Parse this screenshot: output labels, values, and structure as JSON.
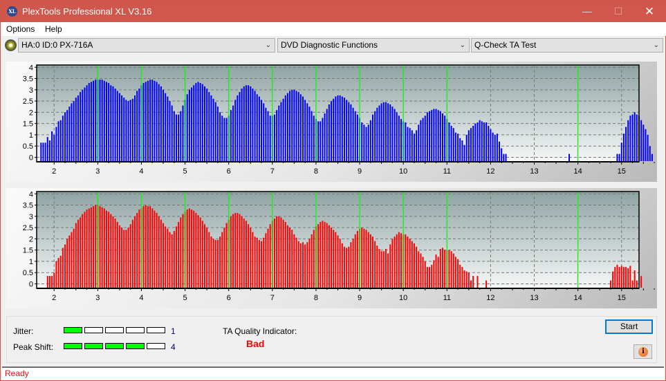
{
  "window": {
    "title": "PlexTools Professional XL V3.16",
    "logo_text": "XL",
    "minimize_icon": "minimize-icon",
    "maximize_icon": "maximize-icon",
    "close_icon": "close-icon"
  },
  "menu": [
    "Options",
    "Help"
  ],
  "toolbar": {
    "drive_icon": "disc-drive-icon",
    "drive": "HA:0 ID:0  PX-716A",
    "function": "DVD Diagnostic Functions",
    "test": "Q-Check TA Test"
  },
  "results": {
    "jitter_label": "Jitter:",
    "jitter_value": "1",
    "jitter_level": 1,
    "peak_shift_label": "Peak Shift:",
    "peak_shift_value": "4",
    "peak_shift_level": 4,
    "segments_total": 5,
    "ta_quality_label": "TA Quality Indicator:",
    "ta_quality_value": "Bad",
    "start_label": "Start",
    "info_icon": "info-icon"
  },
  "status": "Ready",
  "colors": {
    "titlebar": "#d0574b",
    "series_top": "#0000ff",
    "series_bottom": "#ff0000",
    "marker_lines": "#00ff00",
    "level_on": "#00ff00",
    "bad": "#ff0000"
  },
  "chart_data": [
    {
      "type": "bar",
      "name": "TA land/pit histogram (top)",
      "color": "#0000ff",
      "xlim": [
        1.6,
        15.4
      ],
      "ylim": [
        -0.2,
        4.1
      ],
      "xticks": [
        2,
        3,
        4,
        5,
        6,
        7,
        8,
        9,
        10,
        11,
        12,
        13,
        14,
        15
      ],
      "yticks": [
        0,
        0.5,
        1,
        1.5,
        2,
        2.5,
        3,
        3.5,
        4
      ],
      "ytick_labels": [
        "0",
        "0.5",
        "1",
        "1.5",
        "2",
        "2.5",
        "3",
        "3.5",
        "4"
      ],
      "marker_lines_x": [
        3,
        4,
        5,
        6,
        7,
        8,
        9,
        10,
        11,
        14
      ],
      "grid": true,
      "x_start": 1.7,
      "x_step": 0.05,
      "values": [
        0.65,
        0.65,
        0.65,
        0.9,
        0.75,
        1.15,
        1.0,
        1.35,
        1.6,
        1.65,
        1.85,
        2.0,
        2.1,
        2.25,
        2.4,
        2.5,
        2.65,
        2.75,
        2.9,
        3.0,
        3.1,
        3.2,
        3.3,
        3.35,
        3.4,
        3.45,
        3.45,
        3.45,
        3.45,
        3.4,
        3.35,
        3.3,
        3.2,
        3.15,
        3.05,
        2.95,
        2.85,
        2.75,
        2.65,
        2.55,
        2.5,
        2.55,
        2.6,
        2.75,
        2.95,
        3.05,
        3.2,
        3.3,
        3.35,
        3.4,
        3.45,
        3.45,
        3.4,
        3.35,
        3.25,
        3.15,
        3.0,
        2.85,
        2.7,
        2.5,
        2.3,
        2.05,
        1.9,
        1.9,
        2.05,
        2.3,
        2.55,
        2.8,
        3.0,
        3.1,
        3.2,
        3.3,
        3.35,
        3.3,
        3.25,
        3.15,
        3.05,
        2.9,
        2.75,
        2.6,
        2.45,
        2.25,
        2.0,
        1.85,
        1.75,
        1.75,
        1.85,
        2.1,
        2.3,
        2.55,
        2.75,
        2.9,
        3.05,
        3.15,
        3.2,
        3.2,
        3.15,
        3.05,
        2.95,
        2.8,
        2.7,
        2.55,
        2.4,
        2.2,
        2.05,
        1.85,
        1.85,
        1.9,
        2.1,
        2.3,
        2.45,
        2.6,
        2.75,
        2.85,
        2.95,
        3.0,
        3.0,
        2.95,
        2.9,
        2.8,
        2.7,
        2.55,
        2.4,
        2.25,
        2.05,
        1.85,
        1.7,
        1.6,
        1.6,
        1.75,
        1.95,
        2.15,
        2.35,
        2.5,
        2.6,
        2.7,
        2.75,
        2.75,
        2.7,
        2.65,
        2.55,
        2.45,
        2.35,
        2.2,
        2.05,
        1.9,
        1.75,
        1.55,
        1.45,
        1.35,
        1.45,
        1.65,
        1.9,
        2.05,
        2.2,
        2.3,
        2.4,
        2.45,
        2.45,
        2.4,
        2.35,
        2.25,
        2.15,
        2.0,
        1.85,
        1.7,
        1.6,
        1.55,
        1.35,
        1.3,
        1.2,
        1.05,
        1.2,
        1.45,
        1.65,
        1.75,
        1.85,
        2.0,
        2.05,
        2.1,
        2.15,
        2.15,
        2.1,
        2.05,
        1.95,
        1.85,
        1.7,
        1.55,
        1.4,
        1.3,
        1.1,
        1.05,
        0.85,
        0.75,
        0.55,
        1.0,
        1.2,
        1.3,
        1.4,
        1.5,
        1.55,
        1.65,
        1.6,
        1.55,
        1.55,
        1.4,
        1.25,
        1.1,
        1.0,
        1.05,
        0.7,
        0.4,
        0.15,
        0.15,
        0,
        0,
        0,
        0,
        0,
        0,
        0,
        0,
        0,
        0,
        0,
        0,
        0,
        0,
        0,
        0,
        0,
        0,
        0,
        0,
        0,
        0,
        0,
        0,
        0,
        0,
        0,
        0,
        0.15,
        0,
        0,
        0,
        0,
        0,
        0,
        0,
        0,
        0,
        0,
        0,
        0,
        0,
        0,
        0,
        0,
        0,
        0,
        0,
        0,
        0,
        0.15,
        0.15,
        0.65,
        1.05,
        1.35,
        1.65,
        1.85,
        1.9,
        2.0,
        1.9,
        1.85,
        1.65,
        1.45,
        1.25,
        1.0,
        0.5,
        0.15,
        0,
        0,
        0,
        0,
        0,
        0,
        0,
        0,
        0,
        0,
        0,
        0,
        0.15,
        0,
        0,
        0,
        0,
        0
      ]
    },
    {
      "type": "bar",
      "name": "TA land/pit histogram (bottom)",
      "color": "#ff0000",
      "xlim": [
        1.6,
        15.4
      ],
      "ylim": [
        -0.2,
        4.1
      ],
      "xticks": [
        2,
        3,
        4,
        5,
        6,
        7,
        8,
        9,
        10,
        11,
        12,
        13,
        14,
        15
      ],
      "yticks": [
        0,
        0.5,
        1,
        1.5,
        2,
        2.5,
        3,
        3.5,
        4
      ],
      "ytick_labels": [
        "0",
        "0.5",
        "1",
        "1.5",
        "2",
        "2.5",
        "3",
        "3.5",
        "4"
      ],
      "marker_lines_x": [
        3,
        4,
        5,
        6,
        7,
        8,
        9,
        10,
        11,
        14
      ],
      "grid": true,
      "x_start": 1.7,
      "x_step": 0.05,
      "values": [
        0,
        0,
        0,
        0.35,
        0.35,
        0.35,
        0.5,
        1.0,
        1.15,
        1.25,
        1.6,
        1.75,
        2.0,
        2.15,
        2.3,
        2.45,
        2.7,
        2.85,
        2.95,
        3.1,
        3.2,
        3.3,
        3.35,
        3.4,
        3.45,
        3.5,
        3.5,
        3.45,
        3.4,
        3.35,
        3.25,
        3.2,
        3.1,
        3.0,
        2.9,
        2.75,
        2.6,
        2.5,
        2.4,
        2.4,
        2.5,
        2.65,
        2.85,
        3.0,
        3.15,
        3.3,
        3.35,
        3.45,
        3.5,
        3.45,
        3.45,
        3.35,
        3.25,
        3.15,
        3.0,
        2.85,
        2.7,
        2.55,
        2.45,
        2.3,
        2.2,
        2.35,
        2.55,
        2.75,
        2.95,
        3.1,
        3.2,
        3.3,
        3.35,
        3.3,
        3.25,
        3.15,
        3.05,
        2.95,
        2.8,
        2.65,
        2.5,
        2.3,
        2.1,
        2.0,
        1.95,
        1.95,
        2.1,
        2.3,
        2.5,
        2.7,
        2.85,
        3.0,
        3.1,
        3.15,
        3.15,
        3.1,
        3.0,
        2.9,
        2.8,
        2.65,
        2.5,
        2.3,
        2.1,
        2.05,
        1.95,
        1.9,
        2.05,
        2.25,
        2.45,
        2.65,
        2.8,
        2.9,
        3.0,
        3.0,
        2.95,
        2.85,
        2.75,
        2.6,
        2.5,
        2.4,
        2.2,
        2.05,
        1.9,
        1.8,
        1.85,
        1.75,
        1.85,
        2.0,
        2.2,
        2.4,
        2.55,
        2.65,
        2.75,
        2.8,
        2.75,
        2.7,
        2.6,
        2.5,
        2.4,
        2.3,
        2.15,
        2.0,
        1.8,
        1.65,
        1.6,
        1.65,
        1.85,
        2.0,
        2.2,
        2.35,
        2.45,
        2.5,
        2.45,
        2.4,
        2.3,
        2.2,
        2.1,
        1.9,
        1.7,
        1.55,
        1.45,
        1.45,
        1.55,
        1.35,
        1.75,
        2.0,
        2.1,
        2.2,
        2.3,
        2.25,
        2.2,
        2.2,
        2.1,
        2.0,
        1.9,
        1.8,
        1.65,
        1.45,
        1.35,
        1.2,
        1.0,
        0.75,
        0.75,
        0.85,
        1.05,
        1.3,
        1.2,
        1.55,
        1.6,
        1.5,
        1.5,
        1.5,
        1.45,
        1.35,
        1.2,
        1.1,
        0.85,
        0.75,
        0.6,
        0.55,
        0.5,
        0.15,
        0.35,
        0,
        0.35,
        0,
        0,
        0,
        0.15,
        0,
        0,
        0,
        0,
        0,
        0,
        0,
        0,
        0,
        0,
        0,
        0,
        0,
        0,
        0,
        0,
        0,
        0,
        0,
        0,
        0,
        0,
        0,
        0,
        0,
        0,
        0,
        0,
        0,
        0,
        0,
        0,
        0,
        0,
        0,
        0,
        0,
        0,
        0,
        0,
        0,
        0,
        0,
        0,
        0,
        0,
        0,
        0,
        0,
        0,
        0,
        0,
        0,
        0,
        0,
        0,
        0.15,
        0.55,
        0.75,
        0.85,
        0.75,
        0.8,
        0.75,
        0.75,
        0.7,
        0.8,
        0.15,
        0.6,
        0.15,
        0,
        0.35,
        0,
        0,
        0,
        0,
        0,
        0,
        0,
        0,
        0,
        0,
        0,
        0,
        0,
        0,
        0,
        0
      ]
    }
  ]
}
